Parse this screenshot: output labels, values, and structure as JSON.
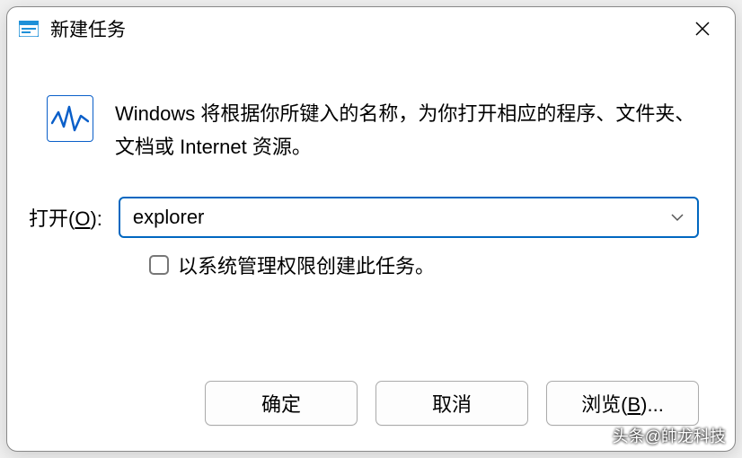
{
  "dialog": {
    "title": "新建任务",
    "info_text": "Windows 将根据你所键入的名称，为你打开相应的程序、文件夹、文档或 Internet 资源。",
    "open_label_prefix": "打开(",
    "open_label_key": "O",
    "open_label_suffix": "):",
    "input_value": "explorer",
    "checkbox_label": "以系统管理权限创建此任务。",
    "buttons": {
      "ok": "确定",
      "cancel": "取消",
      "browse_prefix": "浏览(",
      "browse_key": "B",
      "browse_suffix": ")..."
    }
  },
  "watermark": "头条@帥龙科技"
}
